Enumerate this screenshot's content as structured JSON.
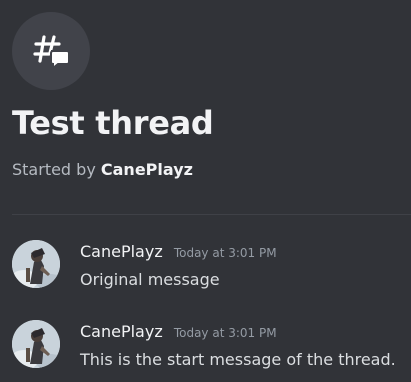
{
  "thread": {
    "icon": "thread-hash-chat-icon",
    "title": "Test thread",
    "started_prefix": "Started by",
    "author": "CanePlayz"
  },
  "messages": [
    {
      "username": "CanePlayz",
      "timestamp": "Today at 3:01 PM",
      "text": "Original message",
      "avatar": "user-avatar"
    },
    {
      "username": "CanePlayz",
      "timestamp": "Today at 3:01 PM",
      "text": "This is the start message of the thread.",
      "avatar": "user-avatar"
    }
  ],
  "colors": {
    "background": "#313338",
    "title": "#f2f3f5",
    "muted": "#b5bac1",
    "timestamp": "#949ba4",
    "icon_circle": "#41434a"
  }
}
